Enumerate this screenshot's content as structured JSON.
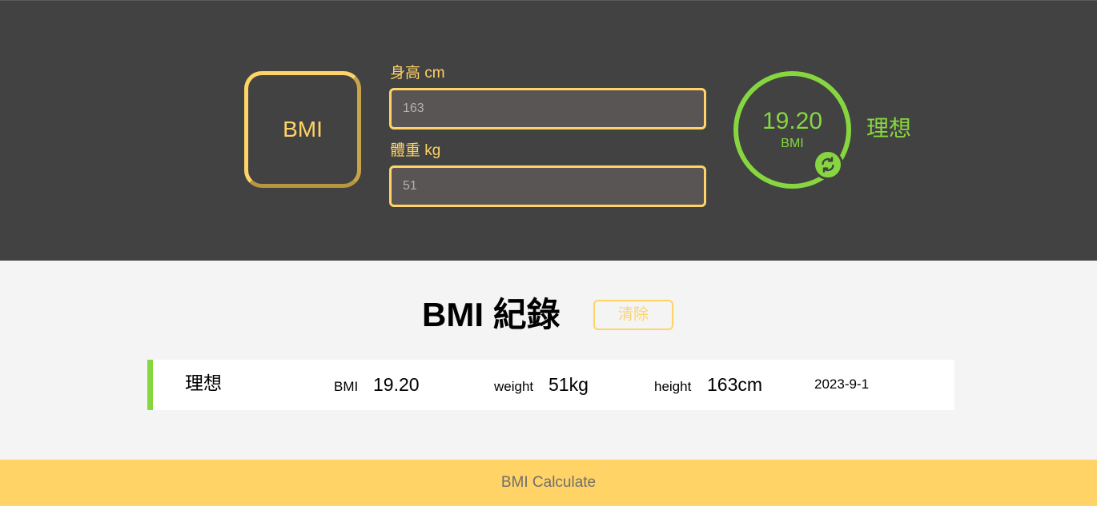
{
  "logo": {
    "text": "BMI"
  },
  "form": {
    "height_label": "身高 cm",
    "height_value": "163",
    "weight_label": "體重 kg",
    "weight_value": "51"
  },
  "result": {
    "value": "19.20",
    "unit": "BMI",
    "status": "理想",
    "refresh_icon": "refresh-icon",
    "color": "#86d73f"
  },
  "records": {
    "title": "BMI 紀錄",
    "clear_label": "清除",
    "items": [
      {
        "status": "理想",
        "bmi_label": "BMI",
        "bmi_value": "19.20",
        "weight_label": "weight",
        "weight_value": "51kg",
        "height_label": "height",
        "height_value": "163cm",
        "date": "2023-9-1"
      }
    ]
  },
  "footer": {
    "text": "BMI Calculate"
  },
  "colors": {
    "accent": "#ffd366",
    "ideal": "#86d73f",
    "dark": "#424242",
    "light": "#f4f4f4"
  }
}
